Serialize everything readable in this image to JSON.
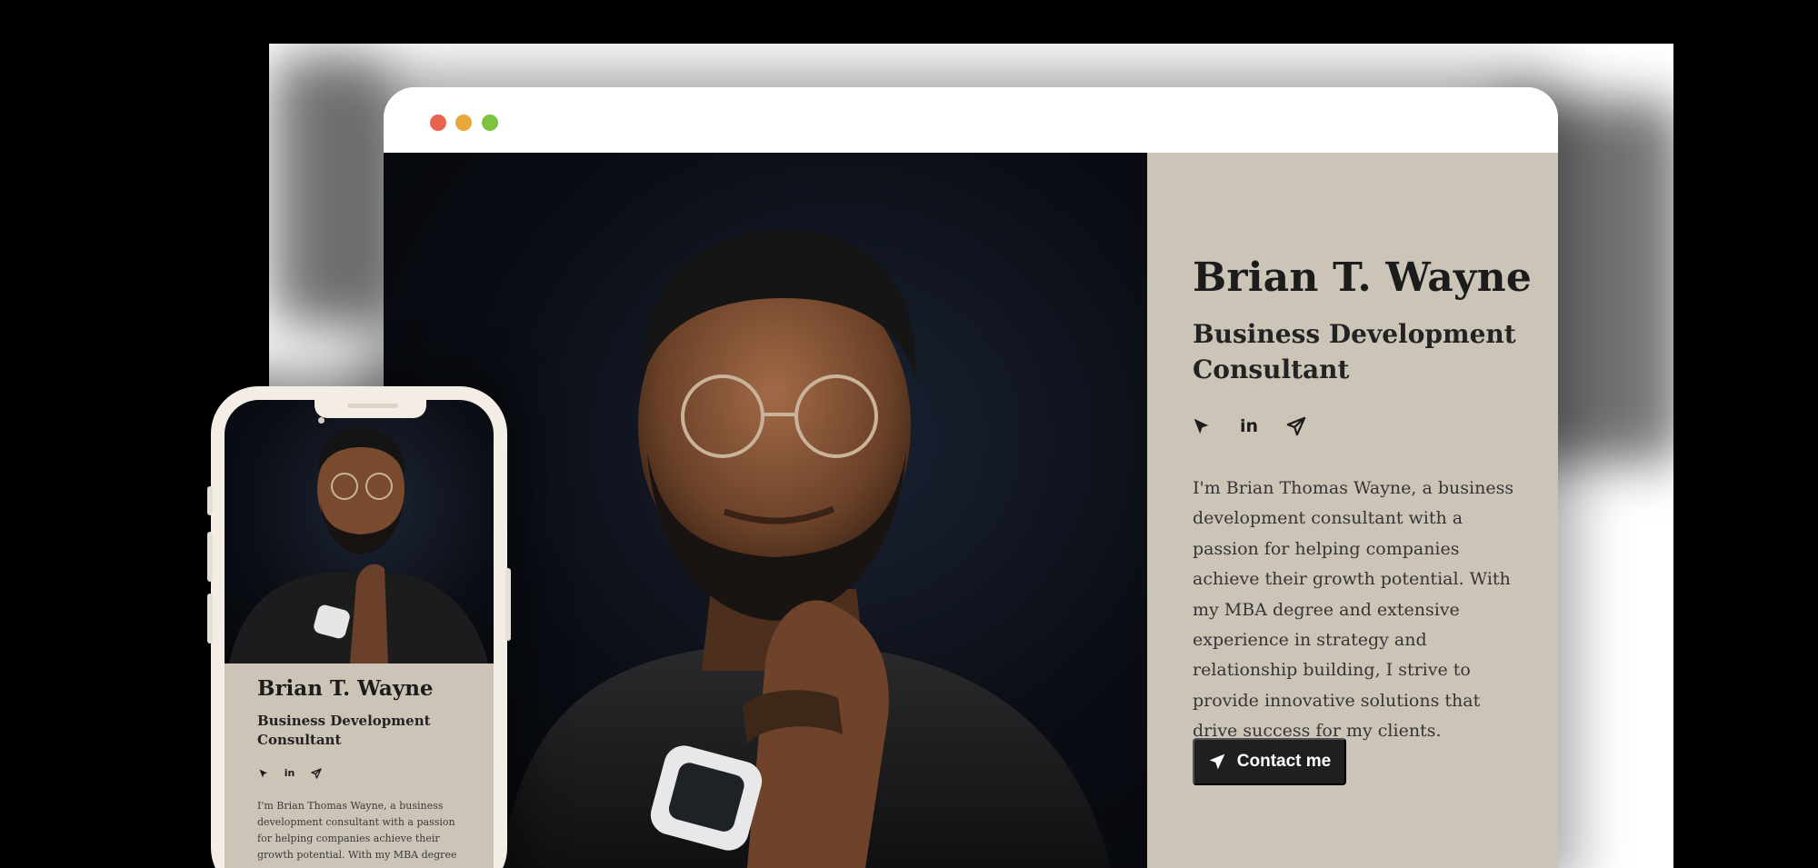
{
  "colors": {
    "panel_bg": "#cdc4b8",
    "text_dark": "#1c1c1c",
    "button_bg": "#1f1f1f",
    "traffic_red": "#e8634c",
    "traffic_yellow": "#e8a93a",
    "traffic_green": "#7cc342"
  },
  "profile": {
    "name": "Brian T. Wayne",
    "role": "Business Development Consultant",
    "bio": "I'm Brian Thomas Wayne, a business development consultant with a passion for helping companies achieve their growth potential. With my MBA degree and extensive experience in strategy and relationship building, I strive to provide innovative solutions that drive success for my clients.",
    "contact_label": "Contact me",
    "photo_alt": "Brian T. Wayne portrait"
  },
  "socials": [
    {
      "icon": "cursor-arrow-icon"
    },
    {
      "icon": "linkedin-icon",
      "text": "in"
    },
    {
      "icon": "paper-plane-icon"
    }
  ],
  "mobile": {
    "name": "Brian T. Wayne",
    "role": "Business Development Consultant",
    "bio": "I'm Brian Thomas Wayne, a business development consultant with a passion for helping companies achieve their growth potential. With my MBA degree"
  }
}
